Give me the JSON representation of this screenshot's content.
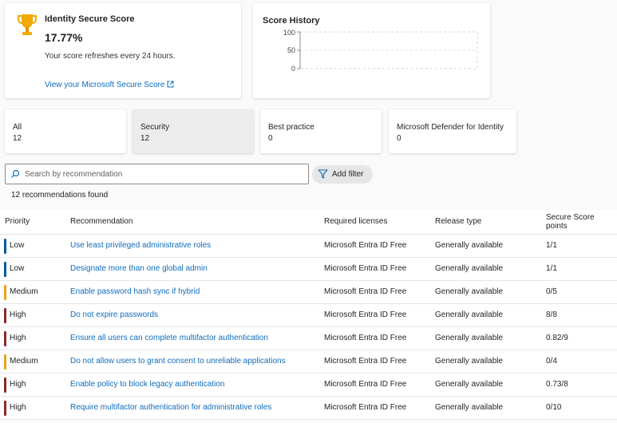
{
  "score_card": {
    "title": "Identity Secure Score",
    "score": "17.77%",
    "refresh_note": "Your score refreshes every 24 hours.",
    "link_label": "View your Microsoft Secure Score",
    "icon": "trophy-icon"
  },
  "history_card": {
    "title": "Score History",
    "y_ticks": [
      "100",
      "50",
      "0"
    ]
  },
  "filters": [
    {
      "name": "All",
      "count": "12",
      "selected": false
    },
    {
      "name": "Security",
      "count": "12",
      "selected": true
    },
    {
      "name": "Best practice",
      "count": "0",
      "selected": false
    },
    {
      "name": "Microsoft Defender for Identity",
      "count": "0",
      "selected": false
    }
  ],
  "search": {
    "placeholder": "Search by recommendation",
    "value": ""
  },
  "add_filter_label": "Add filter",
  "found_text": "12 recommendations found",
  "table": {
    "columns": [
      "Priority",
      "Recommendation",
      "Required licenses",
      "Release type",
      "Secure Score points"
    ],
    "rows": [
      {
        "priority": "Low",
        "recommendation": "Use least privileged administrative roles",
        "license": "Microsoft Entra ID Free",
        "release": "Generally available",
        "points": "1/1"
      },
      {
        "priority": "Low",
        "recommendation": "Designate more than one global admin",
        "license": "Microsoft Entra ID Free",
        "release": "Generally available",
        "points": "1/1"
      },
      {
        "priority": "Medium",
        "recommendation": "Enable password hash sync if hybrid",
        "license": "Microsoft Entra ID Free",
        "release": "Generally available",
        "points": "0/5"
      },
      {
        "priority": "High",
        "recommendation": "Do not expire passwords",
        "license": "Microsoft Entra ID Free",
        "release": "Generally available",
        "points": "8/8"
      },
      {
        "priority": "High",
        "recommendation": "Ensure all users can complete multifactor authentication",
        "license": "Microsoft Entra ID Free",
        "release": "Generally available",
        "points": "0.82/9"
      },
      {
        "priority": "Medium",
        "recommendation": "Do not allow users to grant consent to unreliable applications",
        "license": "Microsoft Entra ID Free",
        "release": "Generally available",
        "points": "0/4"
      },
      {
        "priority": "High",
        "recommendation": "Enable policy to block legacy authentication",
        "license": "Microsoft Entra ID Free",
        "release": "Generally available",
        "points": "0.73/8"
      },
      {
        "priority": "High",
        "recommendation": "Require multifactor authentication for administrative roles",
        "license": "Microsoft Entra ID Free",
        "release": "Generally available",
        "points": "0/10"
      }
    ]
  },
  "colors": {
    "link": "#0f6cbd",
    "priority_low": "#005a9e",
    "priority_medium": "#e8a317",
    "priority_high": "#8b2a2a",
    "trophy": "#f2a900"
  }
}
